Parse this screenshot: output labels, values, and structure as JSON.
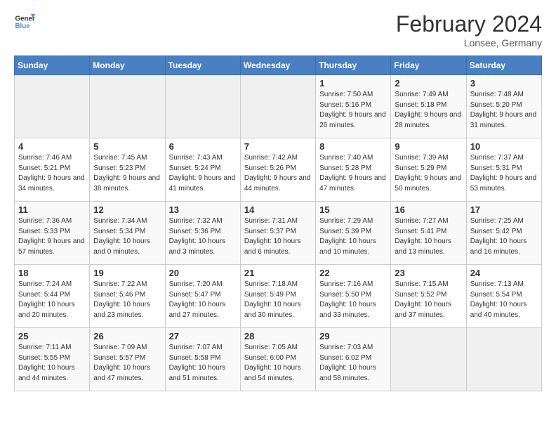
{
  "header": {
    "logo_line1": "General",
    "logo_line2": "Blue",
    "month": "February 2024",
    "location": "Lonsee, Germany"
  },
  "weekdays": [
    "Sunday",
    "Monday",
    "Tuesday",
    "Wednesday",
    "Thursday",
    "Friday",
    "Saturday"
  ],
  "weeks": [
    [
      {
        "day": "",
        "empty": true
      },
      {
        "day": "",
        "empty": true
      },
      {
        "day": "",
        "empty": true
      },
      {
        "day": "",
        "empty": true
      },
      {
        "day": "1",
        "sunrise": "7:50 AM",
        "sunset": "5:16 PM",
        "daylight": "9 hours and 26 minutes."
      },
      {
        "day": "2",
        "sunrise": "7:49 AM",
        "sunset": "5:18 PM",
        "daylight": "9 hours and 28 minutes."
      },
      {
        "day": "3",
        "sunrise": "7:48 AM",
        "sunset": "5:20 PM",
        "daylight": "9 hours and 31 minutes."
      }
    ],
    [
      {
        "day": "4",
        "sunrise": "7:46 AM",
        "sunset": "5:21 PM",
        "daylight": "9 hours and 34 minutes."
      },
      {
        "day": "5",
        "sunrise": "7:45 AM",
        "sunset": "5:23 PM",
        "daylight": "9 hours and 38 minutes."
      },
      {
        "day": "6",
        "sunrise": "7:43 AM",
        "sunset": "5:24 PM",
        "daylight": "9 hours and 41 minutes."
      },
      {
        "day": "7",
        "sunrise": "7:42 AM",
        "sunset": "5:26 PM",
        "daylight": "9 hours and 44 minutes."
      },
      {
        "day": "8",
        "sunrise": "7:40 AM",
        "sunset": "5:28 PM",
        "daylight": "9 hours and 47 minutes."
      },
      {
        "day": "9",
        "sunrise": "7:39 AM",
        "sunset": "5:29 PM",
        "daylight": "9 hours and 50 minutes."
      },
      {
        "day": "10",
        "sunrise": "7:37 AM",
        "sunset": "5:31 PM",
        "daylight": "9 hours and 53 minutes."
      }
    ],
    [
      {
        "day": "11",
        "sunrise": "7:36 AM",
        "sunset": "5:33 PM",
        "daylight": "9 hours and 57 minutes."
      },
      {
        "day": "12",
        "sunrise": "7:34 AM",
        "sunset": "5:34 PM",
        "daylight": "10 hours and 0 minutes."
      },
      {
        "day": "13",
        "sunrise": "7:32 AM",
        "sunset": "5:36 PM",
        "daylight": "10 hours and 3 minutes."
      },
      {
        "day": "14",
        "sunrise": "7:31 AM",
        "sunset": "5:37 PM",
        "daylight": "10 hours and 6 minutes."
      },
      {
        "day": "15",
        "sunrise": "7:29 AM",
        "sunset": "5:39 PM",
        "daylight": "10 hours and 10 minutes."
      },
      {
        "day": "16",
        "sunrise": "7:27 AM",
        "sunset": "5:41 PM",
        "daylight": "10 hours and 13 minutes."
      },
      {
        "day": "17",
        "sunrise": "7:25 AM",
        "sunset": "5:42 PM",
        "daylight": "10 hours and 16 minutes."
      }
    ],
    [
      {
        "day": "18",
        "sunrise": "7:24 AM",
        "sunset": "5:44 PM",
        "daylight": "10 hours and 20 minutes."
      },
      {
        "day": "19",
        "sunrise": "7:22 AM",
        "sunset": "5:46 PM",
        "daylight": "10 hours and 23 minutes."
      },
      {
        "day": "20",
        "sunrise": "7:20 AM",
        "sunset": "5:47 PM",
        "daylight": "10 hours and 27 minutes."
      },
      {
        "day": "21",
        "sunrise": "7:18 AM",
        "sunset": "5:49 PM",
        "daylight": "10 hours and 30 minutes."
      },
      {
        "day": "22",
        "sunrise": "7:16 AM",
        "sunset": "5:50 PM",
        "daylight": "10 hours and 33 minutes."
      },
      {
        "day": "23",
        "sunrise": "7:15 AM",
        "sunset": "5:52 PM",
        "daylight": "10 hours and 37 minutes."
      },
      {
        "day": "24",
        "sunrise": "7:13 AM",
        "sunset": "5:54 PM",
        "daylight": "10 hours and 40 minutes."
      }
    ],
    [
      {
        "day": "25",
        "sunrise": "7:11 AM",
        "sunset": "5:55 PM",
        "daylight": "10 hours and 44 minutes."
      },
      {
        "day": "26",
        "sunrise": "7:09 AM",
        "sunset": "5:57 PM",
        "daylight": "10 hours and 47 minutes."
      },
      {
        "day": "27",
        "sunrise": "7:07 AM",
        "sunset": "5:58 PM",
        "daylight": "10 hours and 51 minutes."
      },
      {
        "day": "28",
        "sunrise": "7:05 AM",
        "sunset": "6:00 PM",
        "daylight": "10 hours and 54 minutes."
      },
      {
        "day": "29",
        "sunrise": "7:03 AM",
        "sunset": "6:02 PM",
        "daylight": "10 hours and 58 minutes."
      },
      {
        "day": "",
        "empty": true
      },
      {
        "day": "",
        "empty": true
      }
    ]
  ],
  "labels": {
    "sunrise_prefix": "Sunrise: ",
    "sunset_prefix": "Sunset: ",
    "daylight_prefix": "Daylight: "
  }
}
